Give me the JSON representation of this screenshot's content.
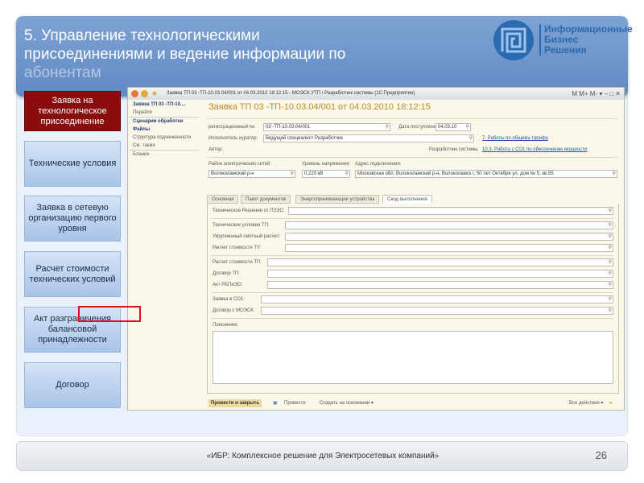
{
  "slide": {
    "title_lines": [
      "5. Управление технологическими",
      "присоединениями  и ведение информации по",
      "абонентам"
    ],
    "logo_text": [
      "Информационные",
      "Бизнес",
      "Решения"
    ],
    "footer": "«ИБР: Комплексное решение для Электросетевых компаний»",
    "page_number": "26"
  },
  "left_nav": [
    {
      "label": "Заявка на технологическое присоединение",
      "active": true
    },
    {
      "label": "Технические условия"
    },
    {
      "label": "Заявка в сетевую организацию первого уровня"
    },
    {
      "label": "Расчет стоимости технических условий"
    },
    {
      "label": "Акт разграничения балансовой принадлежности"
    },
    {
      "label": "Договор"
    }
  ],
  "window": {
    "title": "Заявка ТП 03 -ТП-10.03.04/001 от 04.03.2010 18:12:15 - МОЭСК УТП / Разработчик системы (1С:Предприятие)",
    "nav": {
      "doc": "Заявка ТП 03 -ТП-10....",
      "goto": "Перейти",
      "scenarios": "Сценарии обработки",
      "files": "Файлы",
      "structure": "Структура подчиненности",
      "see_also": "См. также",
      "forms": "Бланки"
    },
    "form_title": "Заявка ТП 03 -ТП-10.03.04/001 от 04.03.2010 18:12:15",
    "reg_label": "регистрационный №:",
    "reg_value": "03 -ТП-10.03.04/001",
    "date_label": "Дата поступления:",
    "date_value": "04.03.10",
    "exec_label": "Исполнитель куратор:",
    "exec_value": "Ведущий специалист Разработчик",
    "link1": "7. Работы по общему тарифу",
    "author_label": "Автор:",
    "dev_label": "Разработчик системы",
    "link2": "10.3. Работа с СО1 по обеспечению мощности",
    "district_label": "Район электрических сетей:",
    "district_value": "Волоколамский р-н",
    "voltage_label": "Уровень напряжения:",
    "voltage_value": "0,220 кВ",
    "address_label": "Адрес подключения:",
    "address_value": "Московская обл, Волоколамский р-н, Волоколамск г, 50 лет Октября ул, дом № 5, кв.55",
    "tabs": [
      "Основная",
      "Пакет документов",
      "Энергопринимающие устройства",
      "Свод выполнения"
    ],
    "fields": [
      "Техническое Решение от ПЗЭС:",
      "Технические условия ТП:",
      "Укрупненный сметный расчет:",
      "Расчет стоимости ТУ:",
      "Расчет стоимости ТП:",
      "Договор ТП:",
      "Акт РБПиЭО:",
      "Заявка в СО1:",
      "Договор с МОЭСК:"
    ],
    "notes_label": "Пояснения:",
    "toolbar": {
      "post_close": "Провести и закрыть",
      "post": "Провести",
      "create_based": "Создать на основании ▾",
      "all_actions": "Все действия ▾"
    }
  },
  "colors": {
    "header": "#6f95c8",
    "active_nav": "#8b0c0c",
    "highlight": "#e0101a"
  }
}
